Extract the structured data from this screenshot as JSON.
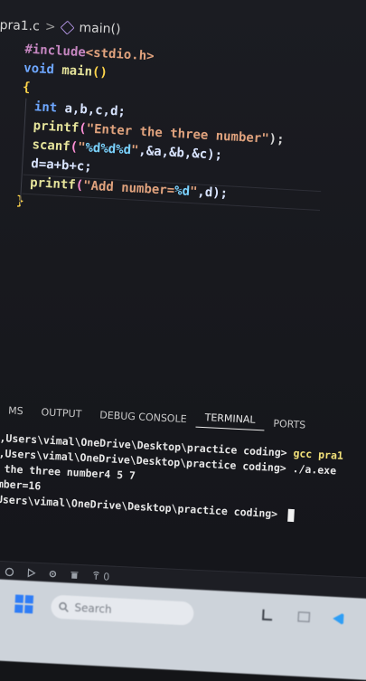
{
  "breadcrumb": {
    "file": "pra1.c",
    "separator": ">",
    "symbol": "main()"
  },
  "code": {
    "include": {
      "directive": "#include",
      "header": "<stdio.h>"
    },
    "main_decl": {
      "type": "void",
      "name": "main",
      "parens": "()"
    },
    "open_brace": "{",
    "decl": {
      "type": "int",
      "vars": " a,b,c,d;"
    },
    "printf1": {
      "fn": "printf",
      "open": "(",
      "str": "\"Enter the three number\"",
      "close": ");"
    },
    "scanf": {
      "fn": "scanf",
      "open": "(",
      "str_a": "\"",
      "fmt": "%d%d%d",
      "str_b": "\"",
      "args": ",&a,&b,&c);"
    },
    "assign": "d=a+b+c;",
    "printf2": {
      "fn": "printf",
      "open": "(",
      "str_a": "\"Add number=",
      "fmt": "%d",
      "str_b": "\"",
      "args": ",d);"
    },
    "close_brace": "}"
  },
  "panel": {
    "tabs": [
      "MS",
      "OUTPUT",
      "DEBUG CONSOLE",
      "TERMINAL",
      "PORTS"
    ],
    "active_tab": "TERMINAL"
  },
  "terminal": {
    "lines": [
      {
        "path": ",Users\\vimal\\OneDrive\\Desktop\\practice coding> ",
        "cmd": "gcc pra1"
      },
      {
        "path": ",Users\\vimal\\OneDrive\\Desktop\\practice coding> ",
        "cmd": "./a.exe"
      },
      {
        "path": " the three number4 5 7",
        "cmd": ""
      },
      {
        "path": "mber=16",
        "cmd": ""
      },
      {
        "path": "Users\\vimal\\OneDrive\\Desktop\\practice coding> ",
        "cmd": ""
      }
    ]
  },
  "statusbar": {
    "ports": "0"
  },
  "taskbar": {
    "search_placeholder": "Search"
  },
  "colors": {
    "keyword": "#c586c0",
    "type": "#6ea7ff",
    "string": "#e0a27d",
    "function": "#e6e49b",
    "brace": "#ffd54a",
    "taskbar": "#cdd3da",
    "windows_blue": "#2f7df6"
  }
}
